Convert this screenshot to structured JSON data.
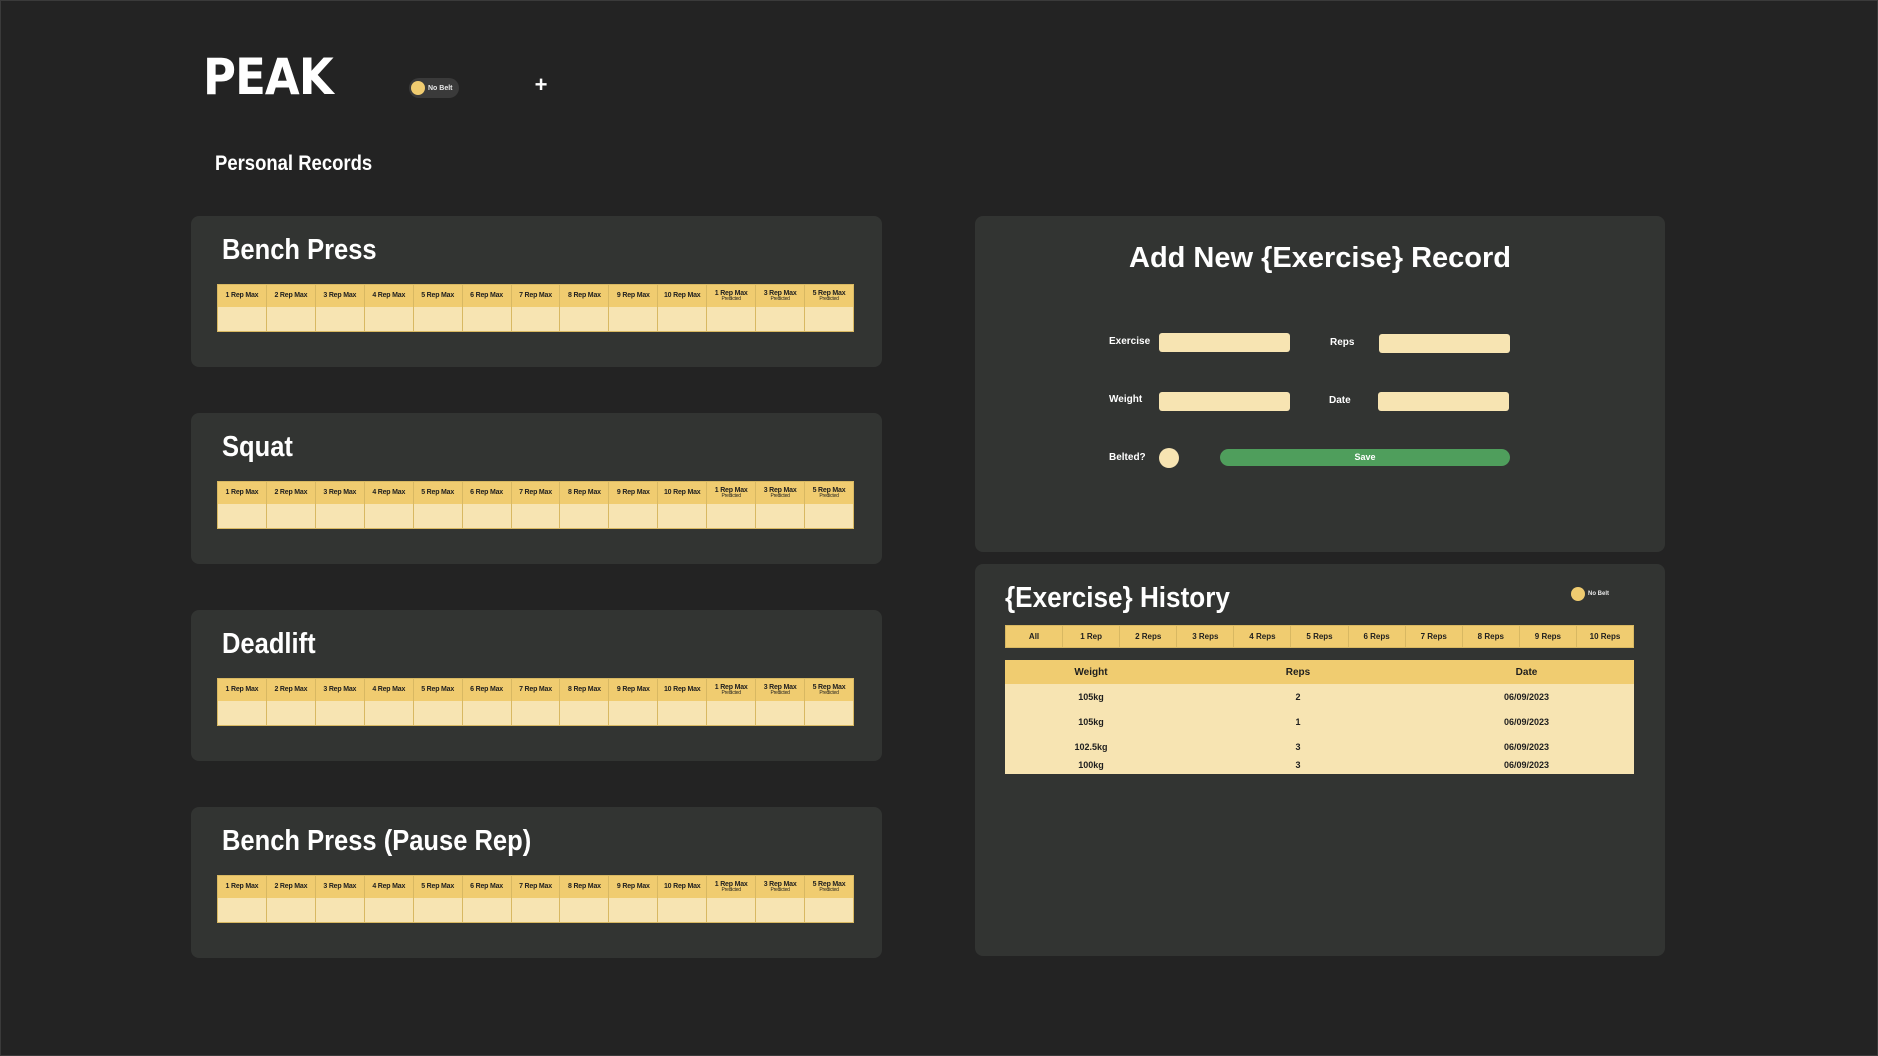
{
  "app": {
    "logo": "PEAK",
    "belt_toggle_label": "No Belt",
    "add_button": "+",
    "section_title": "Personal Records"
  },
  "rm_headers": [
    {
      "label": "1 Rep Max",
      "sub": ""
    },
    {
      "label": "2 Rep Max",
      "sub": ""
    },
    {
      "label": "3 Rep Max",
      "sub": ""
    },
    {
      "label": "4 Rep Max",
      "sub": ""
    },
    {
      "label": "5 Rep Max",
      "sub": ""
    },
    {
      "label": "6 Rep Max",
      "sub": ""
    },
    {
      "label": "7 Rep Max",
      "sub": ""
    },
    {
      "label": "8 Rep Max",
      "sub": ""
    },
    {
      "label": "9 Rep Max",
      "sub": ""
    },
    {
      "label": "10 Rep Max",
      "sub": ""
    },
    {
      "label": "1 Rep Max",
      "sub": "Predicted"
    },
    {
      "label": "3 Rep Max",
      "sub": "Predicted"
    },
    {
      "label": "5 Rep Max",
      "sub": "Predicted"
    }
  ],
  "exercises": [
    {
      "name": "Bench Press"
    },
    {
      "name": "Squat"
    },
    {
      "name": "Deadlift"
    },
    {
      "name": "Bench Press (Pause Rep)"
    }
  ],
  "add_form": {
    "title": "Add New {Exercise} Record",
    "exercise_label": "Exercise",
    "reps_label": "Reps",
    "weight_label": "Weight",
    "date_label": "Date",
    "belted_label": "Belted?",
    "save_label": "Save"
  },
  "history": {
    "title": "{Exercise} History",
    "belt_toggle_label": "No Belt",
    "tabs": [
      "All",
      "1 Rep",
      "2 Reps",
      "3 Reps",
      "4 Reps",
      "5 Reps",
      "6 Reps",
      "7 Reps",
      "8 Reps",
      "9 Reps",
      "10 Reps"
    ],
    "columns": [
      "Weight",
      "Reps",
      "Date"
    ],
    "rows": [
      {
        "weight": "105kg",
        "reps": "2",
        "date": "06/09/2023"
      },
      {
        "weight": "105kg",
        "reps": "1",
        "date": "06/09/2023"
      },
      {
        "weight": "102.5kg",
        "reps": "3",
        "date": "06/09/2023"
      },
      {
        "weight": "100kg",
        "reps": "3",
        "date": "06/09/2023"
      }
    ]
  },
  "colors": {
    "background": "#232323",
    "card": "#323432",
    "header_gold": "#f0cc70",
    "cell_cream": "#f7e4b2",
    "save_green": "#4f9e5c"
  }
}
